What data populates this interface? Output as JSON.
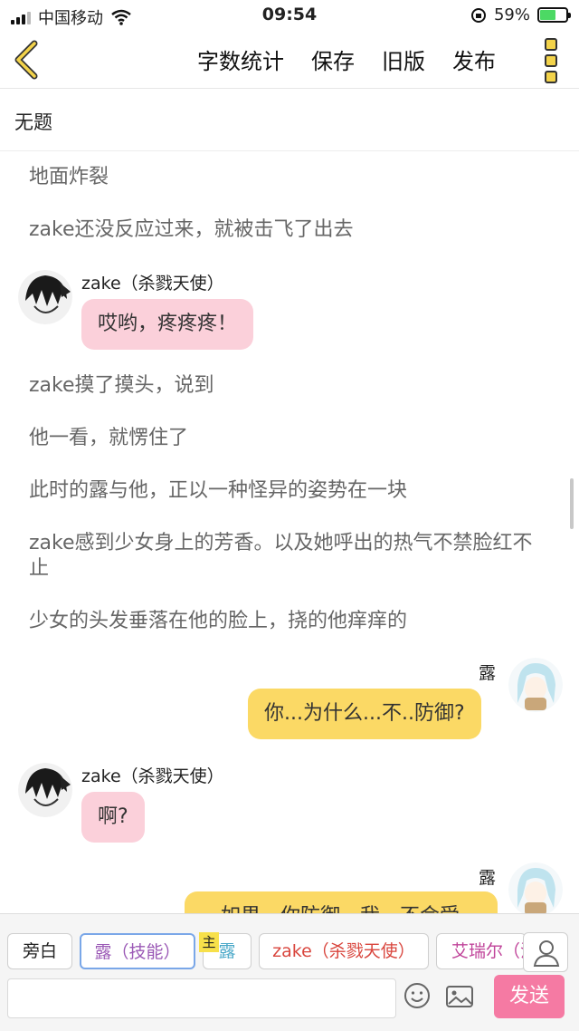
{
  "status_bar": {
    "carrier": "中国移动",
    "time": "09:54",
    "battery": "59%",
    "battery_level": 0.59
  },
  "nav": {
    "items": [
      "字数统计",
      "保存",
      "旧版",
      "发布"
    ]
  },
  "title": "无题",
  "messages": {
    "n1": "地面炸裂",
    "n2": "zake还没反应过来，就被击飞了出去",
    "c1_name": "zake（杀戮天使）",
    "c1_text": "哎哟，疼疼疼！",
    "n3": "zake摸了摸头，说到",
    "n4": "他一看，就愣住了",
    "n5": "此时的露与他，正以一种怪异的姿势在一块",
    "n6": "zake感到少女身上的芳香。以及她呼出的热气不禁脸红不止",
    "n7": "少女的头发垂落在他的脸上，挠的他痒痒的",
    "c2_name": "露",
    "c2_text": "你...为什么...不..防御?",
    "c3_name": "zake（杀戮天使）",
    "c3_text": "啊?",
    "c4_name": "露",
    "c4_text": "…如果…你防御，我…不会受"
  },
  "roles": {
    "narrator": "旁白",
    "lu_skill": "露（技能）",
    "main_tag": "主",
    "lu": "露",
    "zake": "zake（杀戮天使）",
    "airui": "艾瑞尔（法"
  },
  "input": {
    "placeholder": "",
    "send_label": "发送"
  },
  "colors": {
    "accent": "#f3d34a",
    "pink_bubble": "#fbd0da",
    "yellow_bubble": "#fbd965",
    "send": "#f57aa3"
  }
}
